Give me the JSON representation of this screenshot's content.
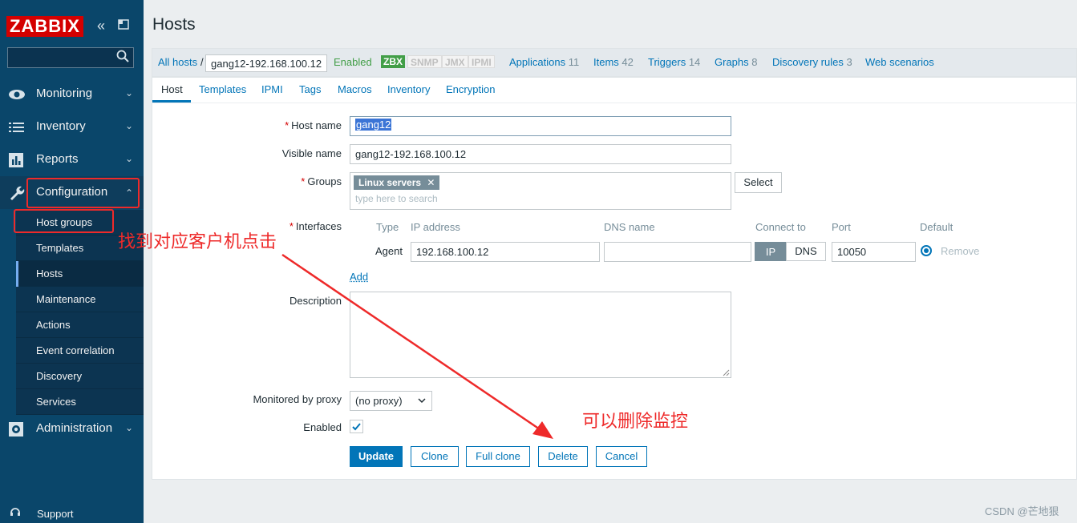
{
  "brand": {
    "logo": "ZABBIX"
  },
  "sidebar": {
    "menu": [
      {
        "label": "Monitoring",
        "icon": "eye-icon"
      },
      {
        "label": "Inventory",
        "icon": "list-icon"
      },
      {
        "label": "Reports",
        "icon": "bar-chart-icon"
      },
      {
        "label": "Configuration",
        "icon": "wrench-icon"
      },
      {
        "label": "Administration",
        "icon": "gear-icon"
      }
    ],
    "config_sub": [
      "Host groups",
      "Templates",
      "Hosts",
      "Maintenance",
      "Actions",
      "Event correlation",
      "Discovery",
      "Services"
    ],
    "support": "Support"
  },
  "page": {
    "title": "Hosts"
  },
  "header": {
    "all_hosts": "All hosts",
    "separator": "/",
    "current_host": "gang12-192.168.100.12",
    "status": "Enabled",
    "availability": [
      "ZBX",
      "SNMP",
      "JMX",
      "IPMI"
    ],
    "links": [
      {
        "label": "Applications",
        "count": "11"
      },
      {
        "label": "Items",
        "count": "42"
      },
      {
        "label": "Triggers",
        "count": "14"
      },
      {
        "label": "Graphs",
        "count": "8"
      },
      {
        "label": "Discovery rules",
        "count": "3"
      },
      {
        "label": "Web scenarios",
        "count": ""
      }
    ]
  },
  "tabs": [
    "Host",
    "Templates",
    "IPMI",
    "Tags",
    "Macros",
    "Inventory",
    "Encryption"
  ],
  "form": {
    "host_name_label": "Host name",
    "host_name_value": "gang12",
    "visible_name_label": "Visible name",
    "visible_name_value": "gang12-192.168.100.12",
    "groups_label": "Groups",
    "group_tag": "Linux servers",
    "group_search_placeholder": "type here to search",
    "select_button": "Select",
    "interfaces_label": "Interfaces",
    "iface_headers": {
      "type": "Type",
      "ip": "IP address",
      "dns": "DNS name",
      "connect": "Connect to",
      "port": "Port",
      "default": "Default"
    },
    "iface": {
      "type": "Agent",
      "ip": "192.168.100.12",
      "dns": "",
      "connect_ip": "IP",
      "connect_dns": "DNS",
      "port": "10050",
      "remove": "Remove"
    },
    "add_link": "Add",
    "description_label": "Description",
    "proxy_label": "Monitored by proxy",
    "proxy_value": "(no proxy)",
    "enabled_label": "Enabled",
    "required_mark": "*"
  },
  "buttons": {
    "update": "Update",
    "clone": "Clone",
    "full_clone": "Full clone",
    "delete": "Delete",
    "cancel": "Cancel"
  },
  "annotations": {
    "find_host": "找到对应客户机点击",
    "can_delete": "可以删除监控",
    "color": "#ee2a2a"
  },
  "watermark": "CSDN @芒地狠",
  "colors": {
    "sidebar": "#0a466a",
    "link": "#0275b8",
    "enabled": "#429e47",
    "logo": "#d40000"
  }
}
